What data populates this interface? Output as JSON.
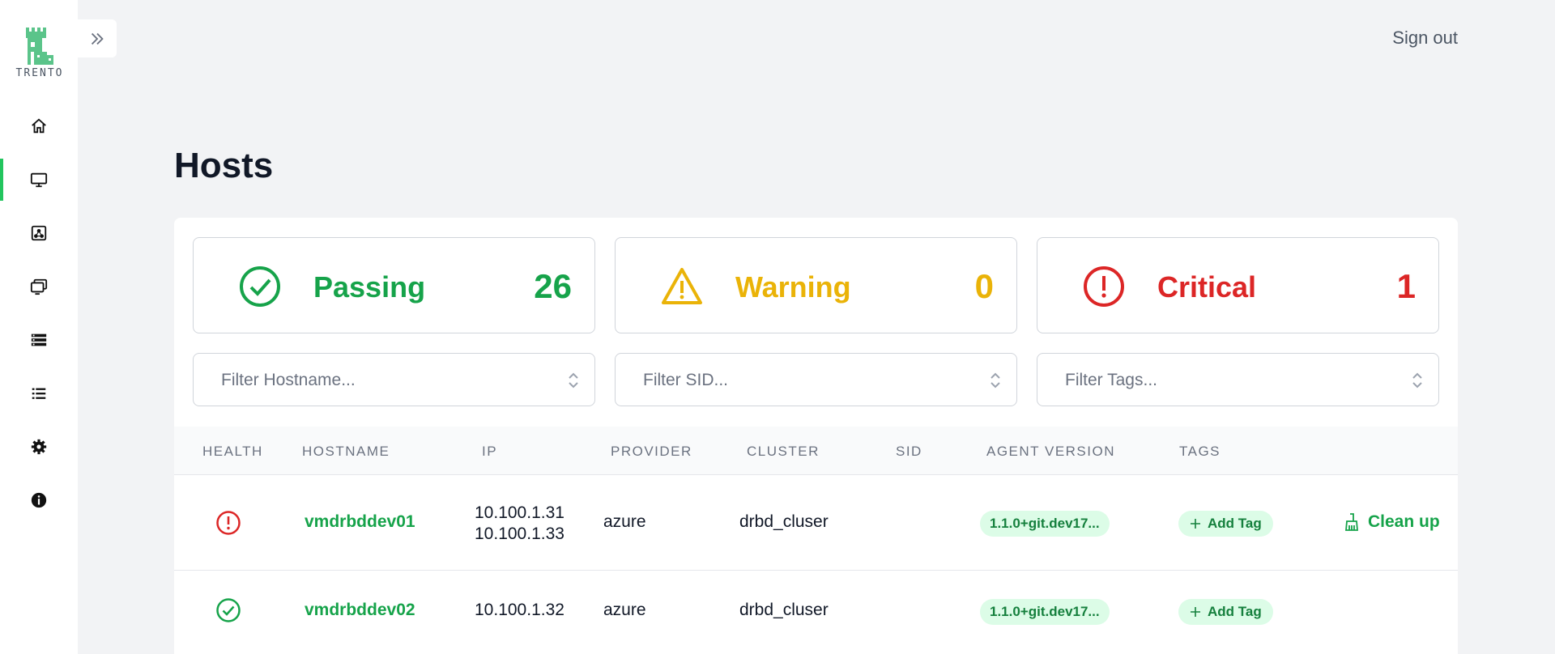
{
  "app": {
    "logo_text": "TRENTO"
  },
  "header": {
    "sign_out": "Sign out"
  },
  "page": {
    "title": "Hosts"
  },
  "health": {
    "passing": {
      "label": "Passing",
      "count": "26",
      "color": "#16a34a"
    },
    "warning": {
      "label": "Warning",
      "count": "0",
      "color": "#eab308"
    },
    "critical": {
      "label": "Critical",
      "count": "1",
      "color": "#dc2626"
    }
  },
  "filters": {
    "hostname": "Filter Hostname...",
    "sid": "Filter SID...",
    "tags": "Filter Tags..."
  },
  "table": {
    "columns": [
      "HEALTH",
      "HOSTNAME",
      "IP",
      "PROVIDER",
      "CLUSTER",
      "SID",
      "AGENT VERSION",
      "TAGS"
    ],
    "rows": [
      {
        "health": "critical",
        "hostname": "vmdrbddev01",
        "ip1": "10.100.1.31",
        "ip2": "10.100.1.33",
        "provider": "azure",
        "cluster": "drbd_cluser",
        "sid": "",
        "agent_version": "1.1.0+git.dev17...",
        "add_tag": "Add Tag",
        "action": "Clean up"
      },
      {
        "health": "passing",
        "hostname": "vmdrbddev02",
        "ip1": "10.100.1.32",
        "ip2": "",
        "provider": "azure",
        "cluster": "drbd_cluser",
        "sid": "",
        "agent_version": "1.1.0+git.dev17...",
        "add_tag": "Add Tag",
        "action": ""
      }
    ]
  },
  "sidebar": {
    "items": [
      {
        "icon": "home-icon"
      },
      {
        "icon": "monitor-icon",
        "active": true
      },
      {
        "icon": "clusters-icon"
      },
      {
        "icon": "windows-icon"
      },
      {
        "icon": "database-icon"
      },
      {
        "icon": "list-icon"
      },
      {
        "icon": "gear-icon"
      },
      {
        "icon": "info-icon"
      }
    ]
  }
}
